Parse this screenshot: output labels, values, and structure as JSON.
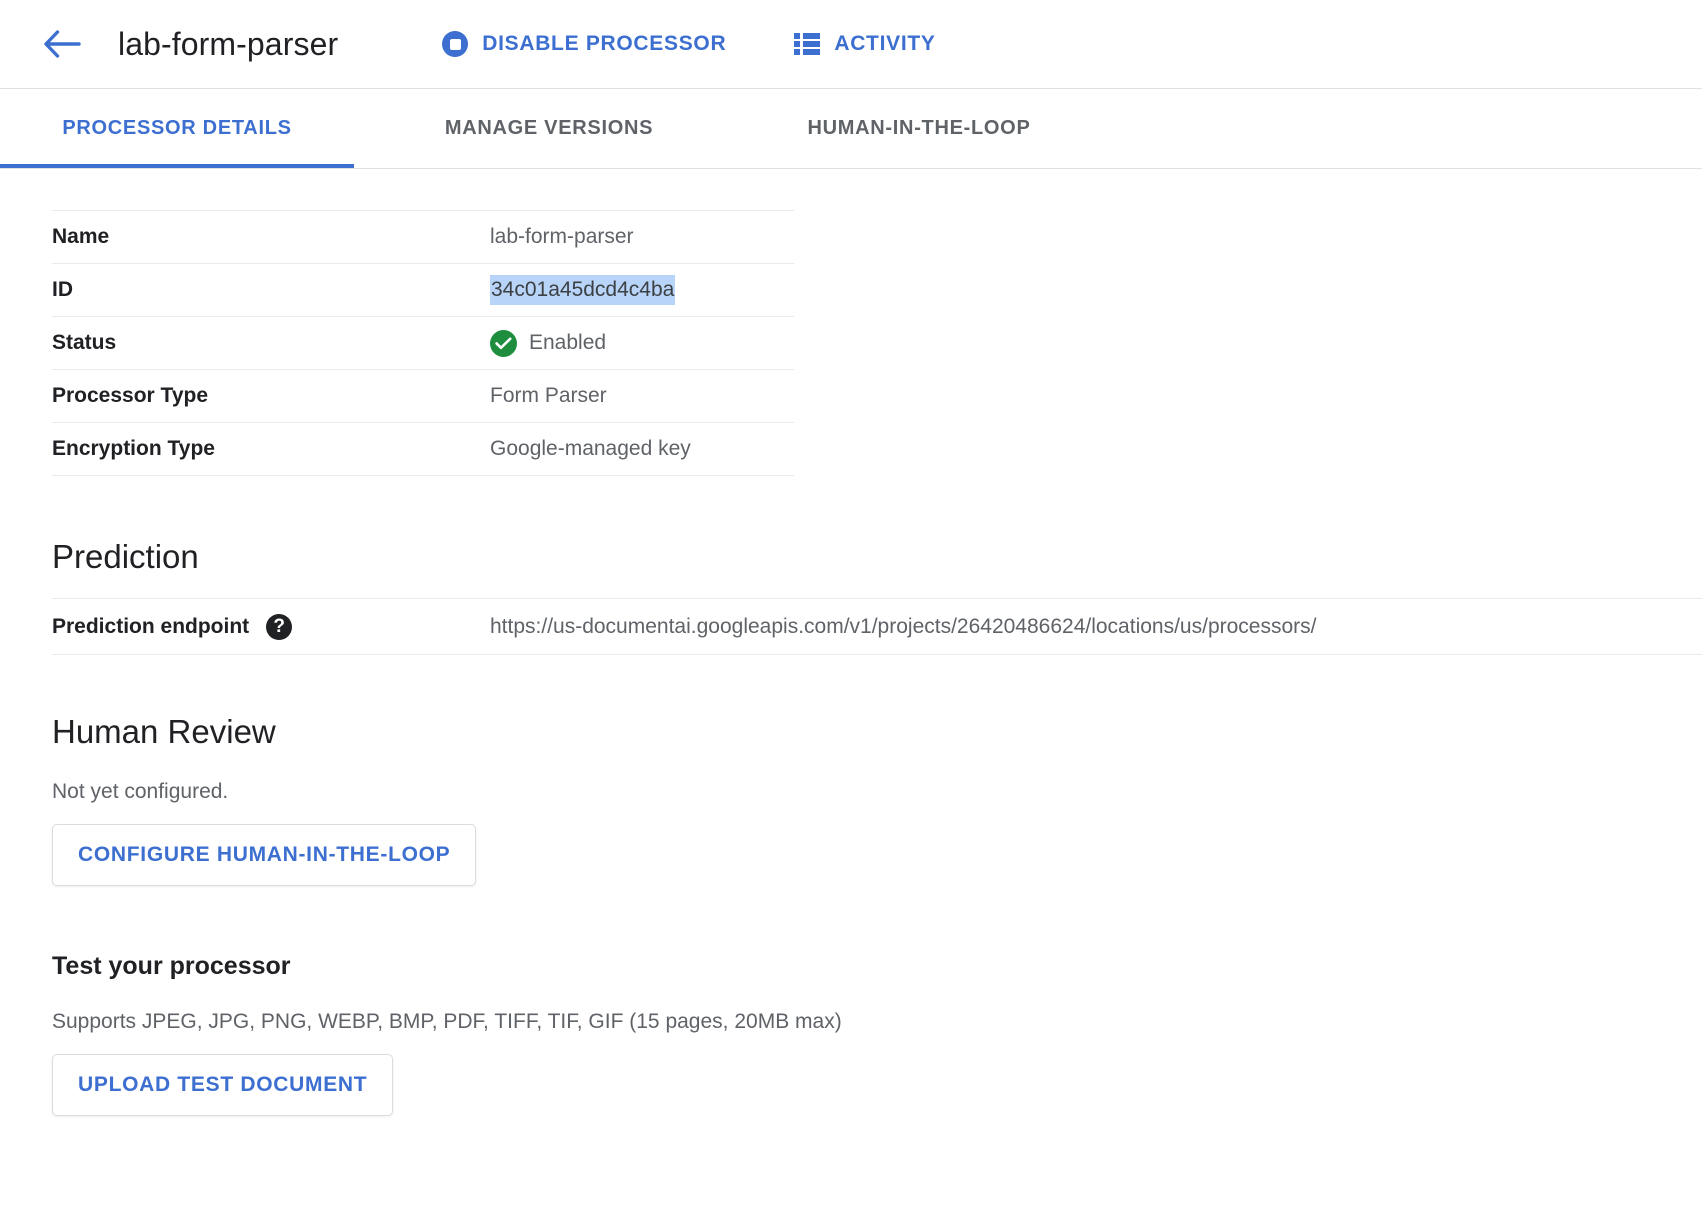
{
  "appbar": {
    "back_icon": "arrow-left-icon",
    "title": "lab-form-parser",
    "actions": [
      {
        "icon": "stop-circle-icon",
        "label": "DISABLE PROCESSOR"
      },
      {
        "icon": "list-icon",
        "label": "ACTIVITY"
      }
    ]
  },
  "tabs": [
    {
      "label": "PROCESSOR DETAILS",
      "active": true
    },
    {
      "label": "MANAGE VERSIONS",
      "active": false
    },
    {
      "label": "HUMAN-IN-THE-LOOP",
      "active": false
    }
  ],
  "details": {
    "rows": [
      {
        "key": "Name",
        "value": "lab-form-parser"
      },
      {
        "key": "ID",
        "value": "34c01a45dcd4c4ba"
      },
      {
        "key": "Status",
        "value": "Enabled"
      },
      {
        "key": "Processor Type",
        "value": "Form Parser"
      },
      {
        "key": "Encryption Type",
        "value": "Google-managed key"
      }
    ]
  },
  "prediction": {
    "heading": "Prediction",
    "endpoint_label": "Prediction endpoint",
    "help_glyph": "?",
    "endpoint_value": "https://us-documentai.googleapis.com/v1/projects/26420486624/locations/us/processors/"
  },
  "human_review": {
    "heading": "Human Review",
    "status_text": "Not yet configured.",
    "button_label": "CONFIGURE HUMAN-IN-THE-LOOP"
  },
  "test_processor": {
    "heading": "Test your processor",
    "supports_text": "Supports JPEG, JPG, PNG, WEBP, BMP, PDF, TIFF, TIF, GIF (15 pages, 20MB max)",
    "button_label": "UPLOAD TEST DOCUMENT"
  },
  "colors": {
    "accent_blue": "#3c6fd0",
    "status_green": "#1e8e3e",
    "selection_blue": "#b8d4f8",
    "divider": "#e8eaed",
    "muted_text": "#5f6368"
  }
}
